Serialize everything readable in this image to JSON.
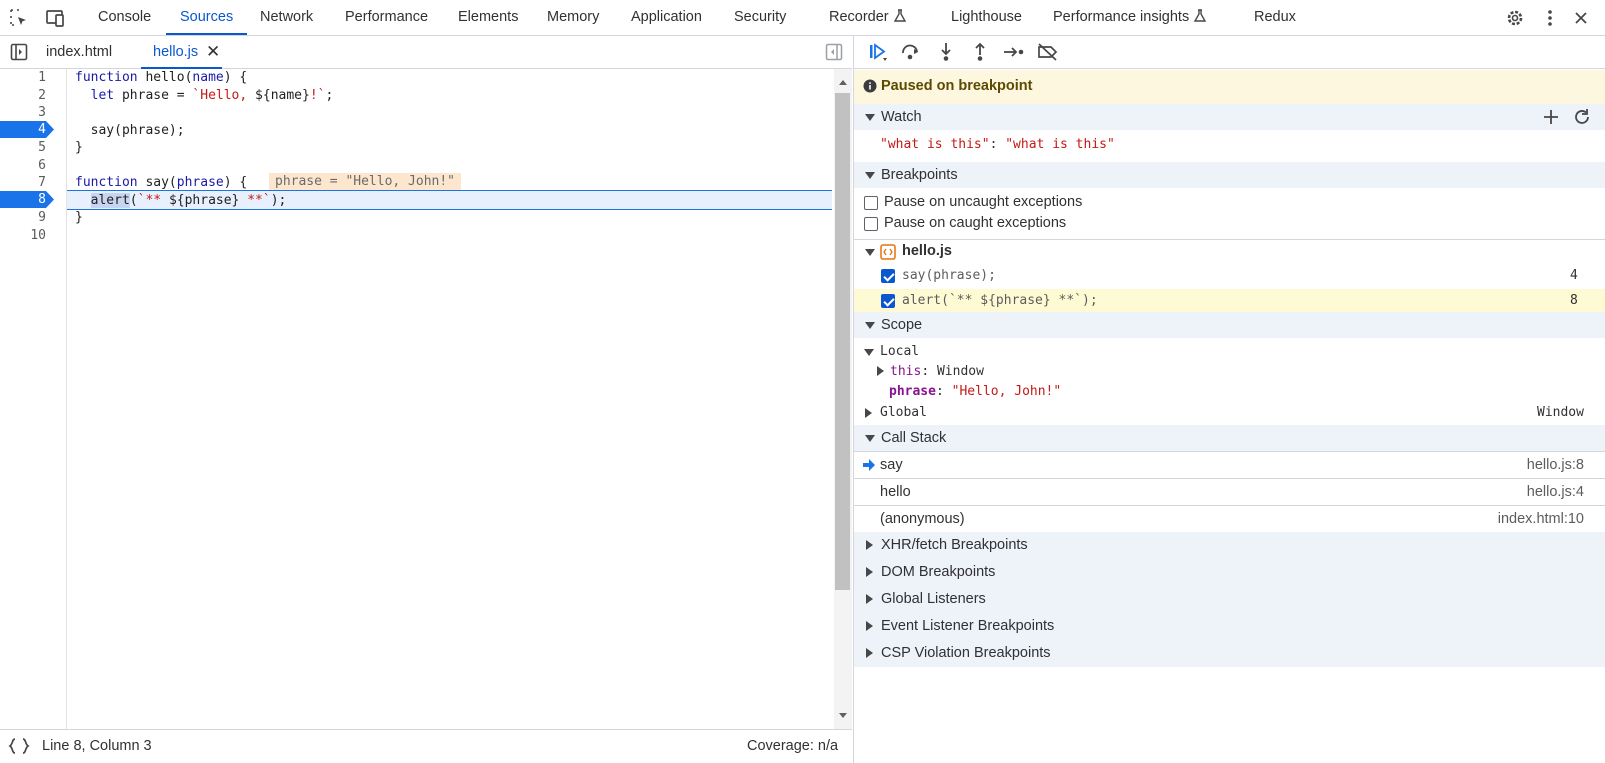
{
  "topbar": {
    "tabs": [
      "Console",
      "Sources",
      "Network",
      "Performance",
      "Elements",
      "Memory",
      "Application",
      "Security",
      "Recorder",
      "Lighthouse",
      "Performance insights",
      "Redux"
    ],
    "active_tab": "Sources",
    "icons": [
      "inspect-element-icon",
      "device-toolbar-icon",
      "settings-icon",
      "more-options-icon",
      "close-icon"
    ]
  },
  "files": {
    "tabs": [
      "index.html",
      "hello.js"
    ],
    "active": "hello.js"
  },
  "editor": {
    "line_numbers": [
      "1",
      "2",
      "3",
      "4",
      "5",
      "6",
      "7",
      "8",
      "9",
      "10"
    ],
    "breakpoint_lines": [
      "4",
      "8"
    ],
    "current_line": "8",
    "lines": [
      {
        "k": "function",
        "rest": " hello(",
        "p": "name",
        "end": ") {"
      },
      {
        "pre": "  ",
        "k": "let",
        "rest": " phrase = ",
        "s": "`Hello, ",
        "mid": "${name}",
        "s2": "!`",
        "end": ";"
      },
      {
        "text": ""
      },
      {
        "text": "  say(phrase);"
      },
      {
        "text": "}"
      },
      {
        "text": ""
      },
      {
        "k": "function",
        "rest": " say(",
        "p": "phrase",
        "end": ") {"
      },
      {
        "pre": "  ",
        "sel": "alert",
        "rest": "(",
        "s": "`** ",
        "mid": "${phrase}",
        "s2": " **`",
        "end": ");"
      },
      {
        "text": "}"
      },
      {
        "text": ""
      }
    ],
    "inline_value": "phrase = \"Hello, John!\""
  },
  "status": {
    "position": "Line 8, Column 3",
    "coverage": "Coverage: n/a"
  },
  "debugger": {
    "paused_message": "Paused on breakpoint",
    "watch": {
      "title": "Watch",
      "expression": "\"what is this\"",
      "value": "\"what is this\""
    },
    "breakpoints": {
      "title": "Breakpoints",
      "uncaught_label": "Pause on uncaught exceptions",
      "caught_label": "Pause on caught exceptions",
      "file": "hello.js",
      "items": [
        {
          "code": "say(phrase);",
          "line": "4"
        },
        {
          "code": "alert(`** ${phrase} **`);",
          "line": "8"
        }
      ]
    },
    "scope": {
      "title": "Scope",
      "local": "Local",
      "this_name": "this",
      "this_value": "Window",
      "var_name": "phrase",
      "var_value": "\"Hello, John!\"",
      "global": "Global",
      "global_value": "Window"
    },
    "call_stack": {
      "title": "Call Stack",
      "frames": [
        {
          "name": "say",
          "loc": "hello.js:8"
        },
        {
          "name": "hello",
          "loc": "hello.js:4"
        },
        {
          "name": "(anonymous)",
          "loc": "index.html:10"
        }
      ]
    },
    "collapsed_sections": [
      "XHR/fetch Breakpoints",
      "DOM Breakpoints",
      "Global Listeners",
      "Event Listener Breakpoints",
      "CSP Violation Breakpoints"
    ]
  },
  "colors": {
    "accent": "#0b57d0",
    "paused_bg": "#fef7e0",
    "breakpoint": "#1a73e8"
  }
}
